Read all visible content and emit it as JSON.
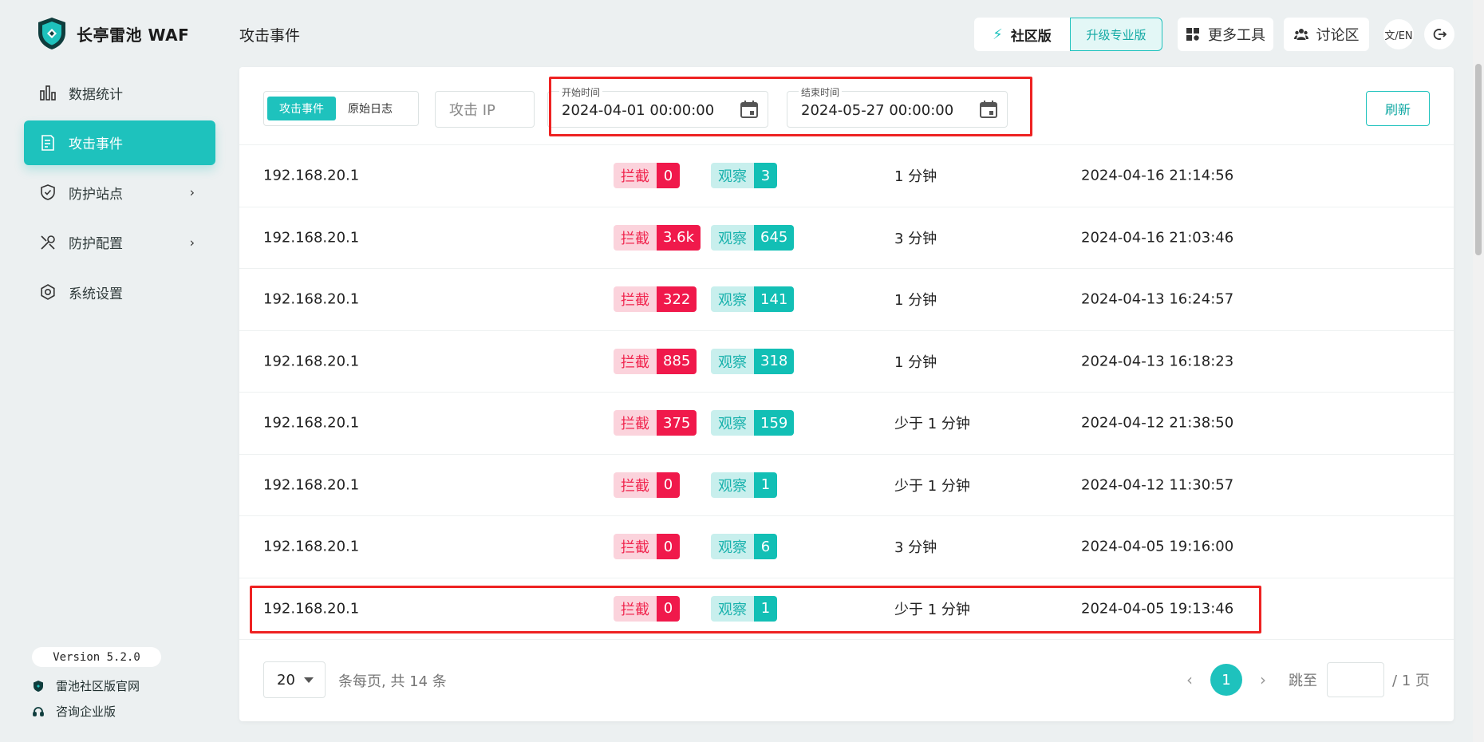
{
  "app": {
    "name": "长亭雷池 WAF"
  },
  "sidebar": {
    "items": [
      {
        "label": "数据统计",
        "icon": "bar-chart-icon"
      },
      {
        "label": "攻击事件",
        "icon": "document-icon",
        "active": true
      },
      {
        "label": "防护站点",
        "icon": "shield-icon",
        "expandable": true
      },
      {
        "label": "防护配置",
        "icon": "tools-icon",
        "expandable": true
      },
      {
        "label": "系统设置",
        "icon": "gear-icon"
      }
    ],
    "version": "Version 5.2.0",
    "links": [
      {
        "label": "雷池社区版官网",
        "icon": "shield-logo-icon"
      },
      {
        "label": "咨询企业版",
        "icon": "headset-icon"
      }
    ]
  },
  "header": {
    "title": "攻击事件",
    "edition": "社区版",
    "upgrade": "升级专业版",
    "more_tools": "更多工具",
    "discuss": "讨论区",
    "lang": "文/EN"
  },
  "filters": {
    "tabs": [
      "攻击事件",
      "原始日志"
    ],
    "ip_placeholder": "攻击 IP",
    "start_label": "开始时间",
    "start_value": "2024-04-01 00:00:00",
    "end_label": "结束时间",
    "end_value": "2024-05-27 00:00:00",
    "refresh": "刷新"
  },
  "tags": {
    "block": "拦截",
    "watch": "观察"
  },
  "events": [
    {
      "ip": "192.168.20.1",
      "blocked": "0",
      "observed": "3",
      "duration": "1 分钟",
      "time": "2024-04-16 21:14:56"
    },
    {
      "ip": "192.168.20.1",
      "blocked": "3.6k",
      "observed": "645",
      "duration": "3 分钟",
      "time": "2024-04-16 21:03:46"
    },
    {
      "ip": "192.168.20.1",
      "blocked": "322",
      "observed": "141",
      "duration": "1 分钟",
      "time": "2024-04-13 16:24:57"
    },
    {
      "ip": "192.168.20.1",
      "blocked": "885",
      "observed": "318",
      "duration": "1 分钟",
      "time": "2024-04-13 16:18:23"
    },
    {
      "ip": "192.168.20.1",
      "blocked": "375",
      "observed": "159",
      "duration": "少于 1 分钟",
      "time": "2024-04-12 21:38:50"
    },
    {
      "ip": "192.168.20.1",
      "blocked": "0",
      "observed": "1",
      "duration": "少于 1 分钟",
      "time": "2024-04-12 11:30:57"
    },
    {
      "ip": "192.168.20.1",
      "blocked": "0",
      "observed": "6",
      "duration": "3 分钟",
      "time": "2024-04-05 19:16:00"
    },
    {
      "ip": "192.168.20.1",
      "blocked": "0",
      "observed": "1",
      "duration": "少于 1 分钟",
      "time": "2024-04-05 19:13:46"
    }
  ],
  "pagination": {
    "page_size": "20",
    "summary": "条每页, 共 14 条",
    "current": "1",
    "jump_label": "跳至",
    "total_pages": "/ 1 页"
  },
  "colors": {
    "accent": "#1ec2bd",
    "block": "#f0194b",
    "highlight": "#ee2222"
  }
}
